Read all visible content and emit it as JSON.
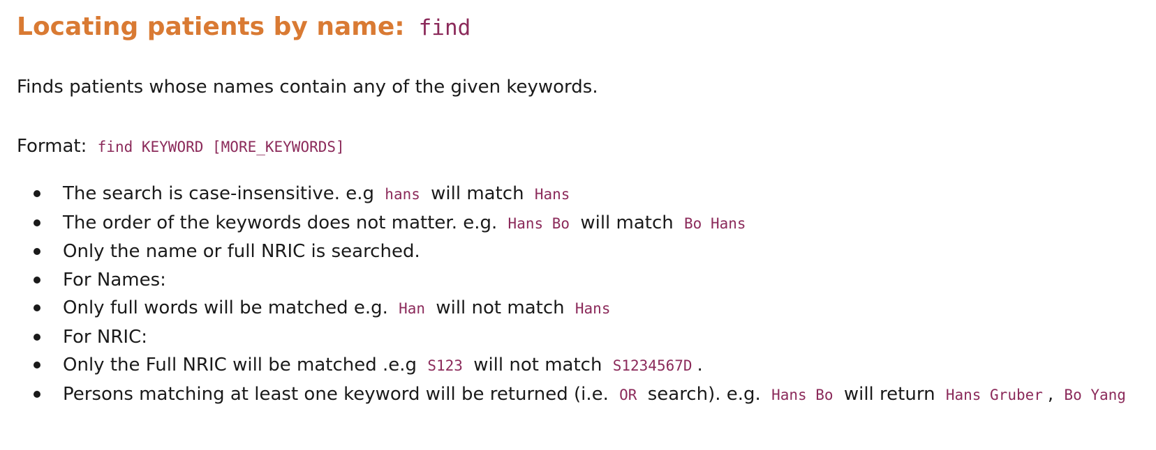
{
  "heading": {
    "text": "Locating patients by name:",
    "command": "find"
  },
  "description": "Finds patients whose names contain any of the given keywords.",
  "format": {
    "label": "Format:",
    "syntax": "find KEYWORD [MORE_KEYWORDS]"
  },
  "bullets": [
    {
      "t1": "The search is case-insensitive. e.g",
      "c1": "hans",
      "t2": "will match",
      "c2": "Hans"
    },
    {
      "t1": "The order of the keywords does not matter. e.g.",
      "c1": "Hans Bo",
      "t2": "will match",
      "c2": "Bo Hans"
    },
    {
      "t1": "Only the name or full NRIC is searched."
    },
    {
      "t1": "For Names:"
    },
    {
      "t1": "Only full words will be matched e.g.",
      "c1": "Han",
      "t2": "will not match",
      "c2": "Hans"
    },
    {
      "t1": "For NRIC:"
    },
    {
      "t1": "Only the Full NRIC will be matched .e.g",
      "c1": "S123",
      "t2": "will not match",
      "c2": "S1234567D",
      "t3": "."
    },
    {
      "t1": "Persons matching at least one keyword will be returned (i.e.",
      "c1": "OR",
      "t2": "search). e.g.",
      "c2": "Hans Bo",
      "t3": "will return",
      "c3": "Hans Gruber",
      "t4": ",",
      "c4": "Bo Yang"
    }
  ],
  "colors": {
    "heading": "#d97a33",
    "code": "#8b2a5a",
    "text": "#1a1a1a"
  }
}
